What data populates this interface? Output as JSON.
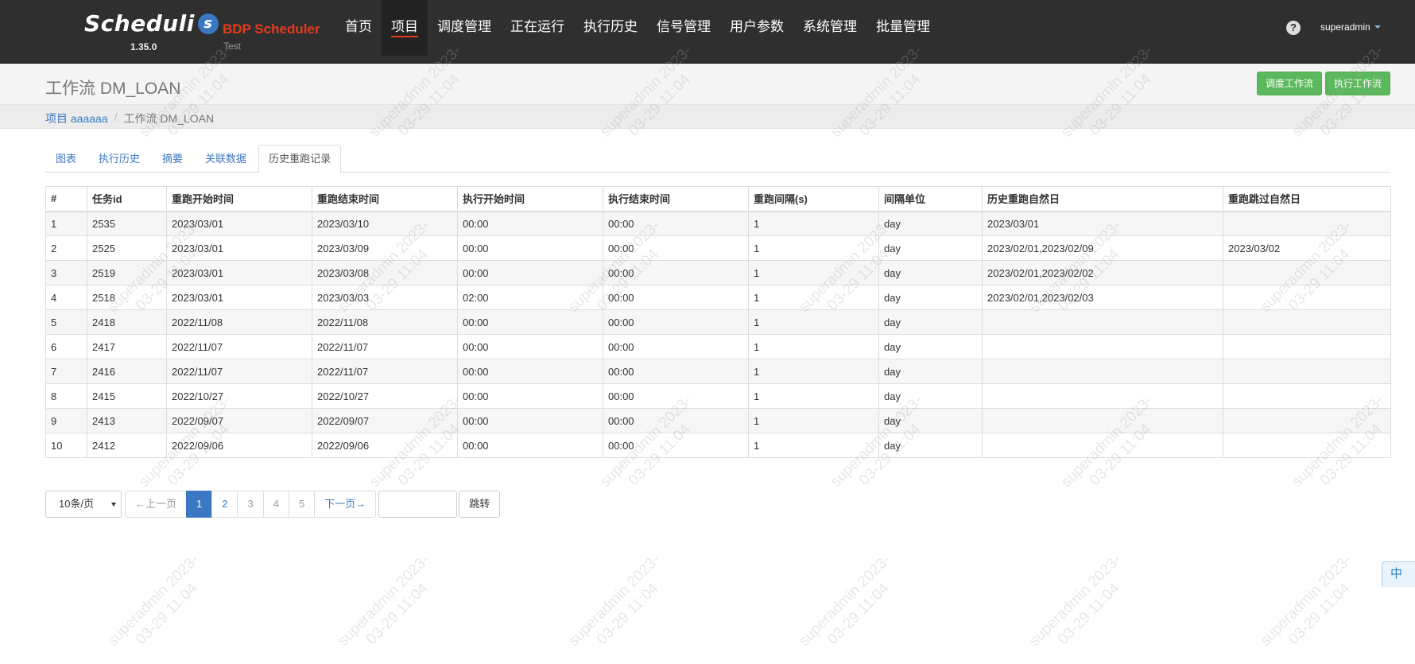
{
  "app": {
    "logo_text": "Scheduli",
    "logo_s": "s",
    "version": "1.35.0",
    "brand_title": "BDP Scheduler",
    "brand_sub": "Test"
  },
  "nav": {
    "items": [
      "首页",
      "项目",
      "调度管理",
      "正在运行",
      "执行历史",
      "信号管理",
      "用户参数",
      "系统管理",
      "批量管理"
    ],
    "active_index": 1,
    "help_icon": "?",
    "user": "superadmin"
  },
  "header": {
    "title": "工作流 DM_LOAN",
    "schedule_button": "调度工作流",
    "execute_button": "执行工作流"
  },
  "breadcrumb": {
    "project_link": "项目 aaaaaa",
    "separator": "/",
    "current": "工作流 DM_LOAN"
  },
  "tabs": [
    "图表",
    "执行历史",
    "摘要",
    "关联数据",
    "历史重跑记录"
  ],
  "active_tab": 4,
  "table": {
    "columns": [
      "#",
      "任务id",
      "重跑开始时间",
      "重跑结束时间",
      "执行开始时间",
      "执行结束时间",
      "重跑间隔(s)",
      "间隔单位",
      "历史重跑自然日",
      "重跑跳过自然日"
    ],
    "rows": [
      [
        "1",
        "2535",
        "2023/03/01",
        "2023/03/10",
        "00:00",
        "00:00",
        "1",
        "day",
        "2023/03/01",
        ""
      ],
      [
        "2",
        "2525",
        "2023/03/01",
        "2023/03/09",
        "00:00",
        "00:00",
        "1",
        "day",
        "2023/02/01,2023/02/09",
        "2023/03/02"
      ],
      [
        "3",
        "2519",
        "2023/03/01",
        "2023/03/08",
        "00:00",
        "00:00",
        "1",
        "day",
        "2023/02/01,2023/02/02",
        ""
      ],
      [
        "4",
        "2518",
        "2023/03/01",
        "2023/03/03",
        "02:00",
        "00:00",
        "1",
        "day",
        "2023/02/01,2023/02/03",
        ""
      ],
      [
        "5",
        "2418",
        "2022/11/08",
        "2022/11/08",
        "00:00",
        "00:00",
        "1",
        "day",
        "",
        ""
      ],
      [
        "6",
        "2417",
        "2022/11/07",
        "2022/11/07",
        "00:00",
        "00:00",
        "1",
        "day",
        "",
        ""
      ],
      [
        "7",
        "2416",
        "2022/11/07",
        "2022/11/07",
        "00:00",
        "00:00",
        "1",
        "day",
        "",
        ""
      ],
      [
        "8",
        "2415",
        "2022/10/27",
        "2022/10/27",
        "00:00",
        "00:00",
        "1",
        "day",
        "",
        ""
      ],
      [
        "9",
        "2413",
        "2022/09/07",
        "2022/09/07",
        "00:00",
        "00:00",
        "1",
        "day",
        "",
        ""
      ],
      [
        "10",
        "2412",
        "2022/09/06",
        "2022/09/06",
        "00:00",
        "00:00",
        "1",
        "day",
        "",
        ""
      ]
    ]
  },
  "pagination": {
    "page_size": "10条/页",
    "prev": "←上一页",
    "pages": [
      "1",
      "2",
      "3",
      "4",
      "5"
    ],
    "current_page": "1",
    "next": "下一页→",
    "jump_value": "",
    "jump_button": "跳转"
  },
  "ime": "中",
  "watermark": {
    "line1": "superadmin 2023-",
    "line2": "03-29 11:04"
  }
}
